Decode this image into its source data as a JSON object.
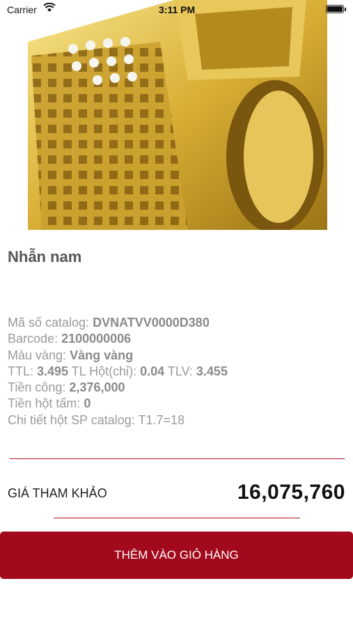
{
  "status_bar": {
    "carrier": "Carrier",
    "time": "3:11 PM"
  },
  "product": {
    "name": "Nhẫn nam",
    "image_icon": "gold-ring-image"
  },
  "details": {
    "catalog_label": "Mã số catalog:",
    "catalog_value": "DVNATVV0000D380",
    "barcode_label": "Barcode:",
    "barcode_value": "2100000006",
    "color_label": "Màu vàng:",
    "color_value": "Vàng vàng",
    "ttl_label": "TTL:",
    "ttl_value": "3.495",
    "tl_hot_label": "TL Hột(chỉ):",
    "tl_hot_value": "0.04",
    "tlv_label": "TLV:",
    "tlv_value": "3.455",
    "labor_label": "Tiền công:",
    "labor_value": "2,376,000",
    "stone_label": "Tiền hột tấm:",
    "stone_value": "0",
    "stone_detail_label": "Chi tiết hột SP catalog:",
    "stone_detail_value": "T1.7=18"
  },
  "price": {
    "label": "GIÁ THAM KHẢO",
    "value": "16,075,760"
  },
  "actions": {
    "add_to_cart": "THÊM VÀO GIỎ HÀNG"
  },
  "colors": {
    "accent": "#a3091c",
    "gold": "#d9b23b"
  }
}
